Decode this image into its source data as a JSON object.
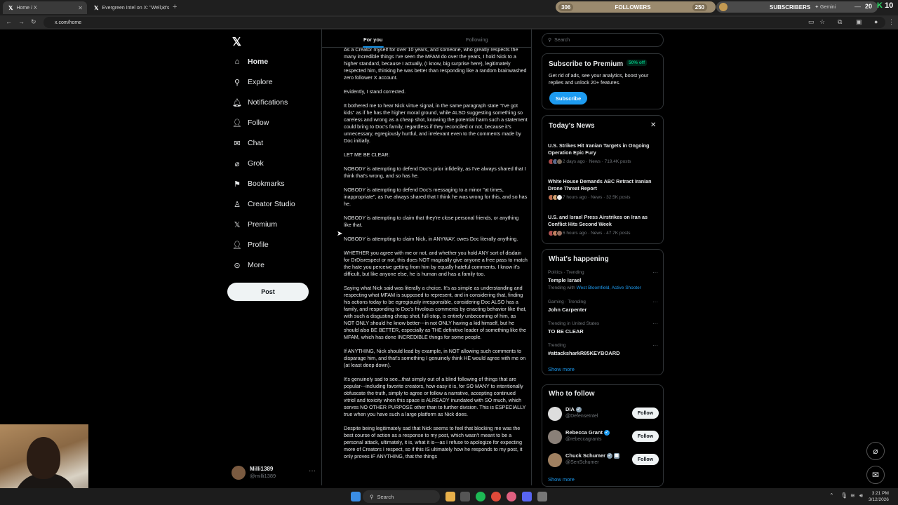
{
  "browser": {
    "tabs": [
      {
        "title": "Home / X"
      },
      {
        "title": "Evergreen Intel on X: \"Well, it's"
      }
    ],
    "url": "x.com/home",
    "overlay": {
      "followers_label": "FOLLOWERS",
      "followers_left": "306",
      "followers_right": "250",
      "subscribers_label": "SUBSCRIBERS",
      "gemini": "Gemini",
      "count": "20",
      "k_badge": "K",
      "k_count": "10"
    }
  },
  "sidebar": {
    "items": [
      {
        "label": "Home",
        "icon": "home-icon"
      },
      {
        "label": "Explore",
        "icon": "search-icon"
      },
      {
        "label": "Notifications",
        "icon": "bell-icon"
      },
      {
        "label": "Follow",
        "icon": "person-add-icon"
      },
      {
        "label": "Chat",
        "icon": "mail-icon"
      },
      {
        "label": "Grok",
        "icon": "grok-icon"
      },
      {
        "label": "Bookmarks",
        "icon": "bookmark-icon"
      },
      {
        "label": "Creator Studio",
        "icon": "creator-icon"
      },
      {
        "label": "Premium",
        "icon": "x-icon"
      },
      {
        "label": "Profile",
        "icon": "person-icon"
      },
      {
        "label": "More",
        "icon": "more-circle-icon"
      }
    ],
    "post_label": "Post",
    "user": {
      "name": "Milli1389",
      "handle": "@milli1389"
    }
  },
  "feed": {
    "tabs": [
      "For you",
      "Following"
    ],
    "paragraphs": [
      "As a Creator myself for over 10 years, and someone, who greatly respects the many incredible things I've seen the MFAM do over the years, I hold Nick to a higher standard, because I actually, (I know, big surprise here), legitimately respected him, thinking he was better than responding like a random brainwashed zero follower X account.",
      "Evidently, I stand corrected.",
      "It bothered me to hear Nick virtue signal, in the same paragraph state \"I've got kids\" as if he has the higher moral ground, while ALSO suggesting something so careless and wrong as a cheap shot, knowing the potential harm such a statement could bring to Doc's family, regardless if they reconciled or not, because it's unnecessary, egregiously hurtful, and irrelevant even to the comments made by Doc initially.",
      "LET ME BE CLEAR:",
      "NOBODY is attempting to defend Doc's prior infidelity, as I've always shared that I think that's wrong, and so has he.",
      "NOBODY is attempting to defend Doc's messaging to a minor \"at times, inappropriate\", as I've always shared that I think he was wrong for this, and so has he.",
      "NOBODY is attempting to claim that they're close personal friends, or anything like that.",
      "NOBODY is attempting to claim Nick, in ANYWAY, owes Doc literally anything.",
      "WHETHER you agree with me or not, and whether you hold ANY sort of disdain for DrDisrespect or not, this does NOT magically give anyone a free pass to match the hate you perceive getting from him by equally hateful comments. I know it's difficult, but like anyone else, he is human and has a family too.",
      "Saying what Nick said was literally a choice. It's as simple as understanding and respecting what MFAM is supposed to represent, and in considering that, finding his actions today to be egregiously irresponsible, considering Doc ALSO has a family, and responding to Doc's frivolous comments by enacting behavior like that, with such a disgusting cheap shot, full-stop, is entirely unbecoming of him, as NOT ONLY should he know better---in not ONLY having a kid himself, but he should also BE BETTER, especially as THE definitive leader of something like the MFAM, which has done INCREDIBLE things for some people.",
      "If ANYTHING, Nick should lead by example, in NOT allowing such comments to disparage him, and that's something I genuinely think HE would agree with me on (at least deep down).",
      "It's genuinely sad to see...that simply out of a blind following of things that are popular---including favorite creators, how easy it is, for SO MANY to intentionally obfuscate the truth, simply to agree or follow a narrative, accepting continued vitriol and toxicity when this space is ALREADY inundated with SO much, which serves NO OTHER PURPOSE other than to further division. This is ESPECIALLY true when you have such a large platform as Nick does.",
      "Despite being legitimately sad that Nick seems to feel that blocking me was the best course of action as a response to my post, which wasn't meant to be a personal attack, ultimately, it is, what it is---as I refuse to apologize for expecting more of Creators I respect, so if this IS ultimately how he responds to my post, it only proves IF ANYTHING, that the things"
    ]
  },
  "right": {
    "search_placeholder": "Search",
    "premium": {
      "title": "Subscribe to Premium",
      "badge": "50% off",
      "text": "Get rid of ads, see your analytics, boost your replies and unlock 20+ features.",
      "button": "Subscribe"
    },
    "news": {
      "title": "Today's News",
      "items": [
        {
          "title": "U.S. Strikes Hit Iranian Targets in Ongoing Operation Epic Fury",
          "meta": "2 days ago · News · 719.4K posts"
        },
        {
          "title": "White House Demands ABC Retract Iranian Drone Threat Report",
          "meta": "7 hours ago · News · 32.5K posts"
        },
        {
          "title": "U.S. and Israel Press Airstrikes on Iran as Conflict Hits Second Week",
          "meta": "6 hours ago · News · 47.7K posts"
        }
      ]
    },
    "happening": {
      "title": "What's happening",
      "items": [
        {
          "context": "Politics · Trending",
          "name": "Temple Israel",
          "sub_prefix": "Trending with ",
          "sub_links": "West Bloomfield, Active Shooter"
        },
        {
          "context": "Gaming · Trending",
          "name": "John Carpenter"
        },
        {
          "context": "Trending in United States",
          "name": "TO BE CLEAR"
        },
        {
          "context": "Trending",
          "name": "#attacksharkR85KEYBOARD"
        }
      ],
      "show_more": "Show more"
    },
    "who_to_follow": {
      "title": "Who to follow",
      "items": [
        {
          "name": "DIA",
          "handle": "@DefenseIntel",
          "button": "Follow"
        },
        {
          "name": "Rebecca Grant",
          "handle": "@rebeccagrants",
          "button": "Follow"
        },
        {
          "name": "Chuck Schumer",
          "handle": "@SenSchumer",
          "button": "Follow"
        }
      ],
      "show_more": "Show more"
    }
  },
  "taskbar": {
    "search_label": "Search",
    "time": "3:21 PM",
    "date": "3/12/2026"
  }
}
